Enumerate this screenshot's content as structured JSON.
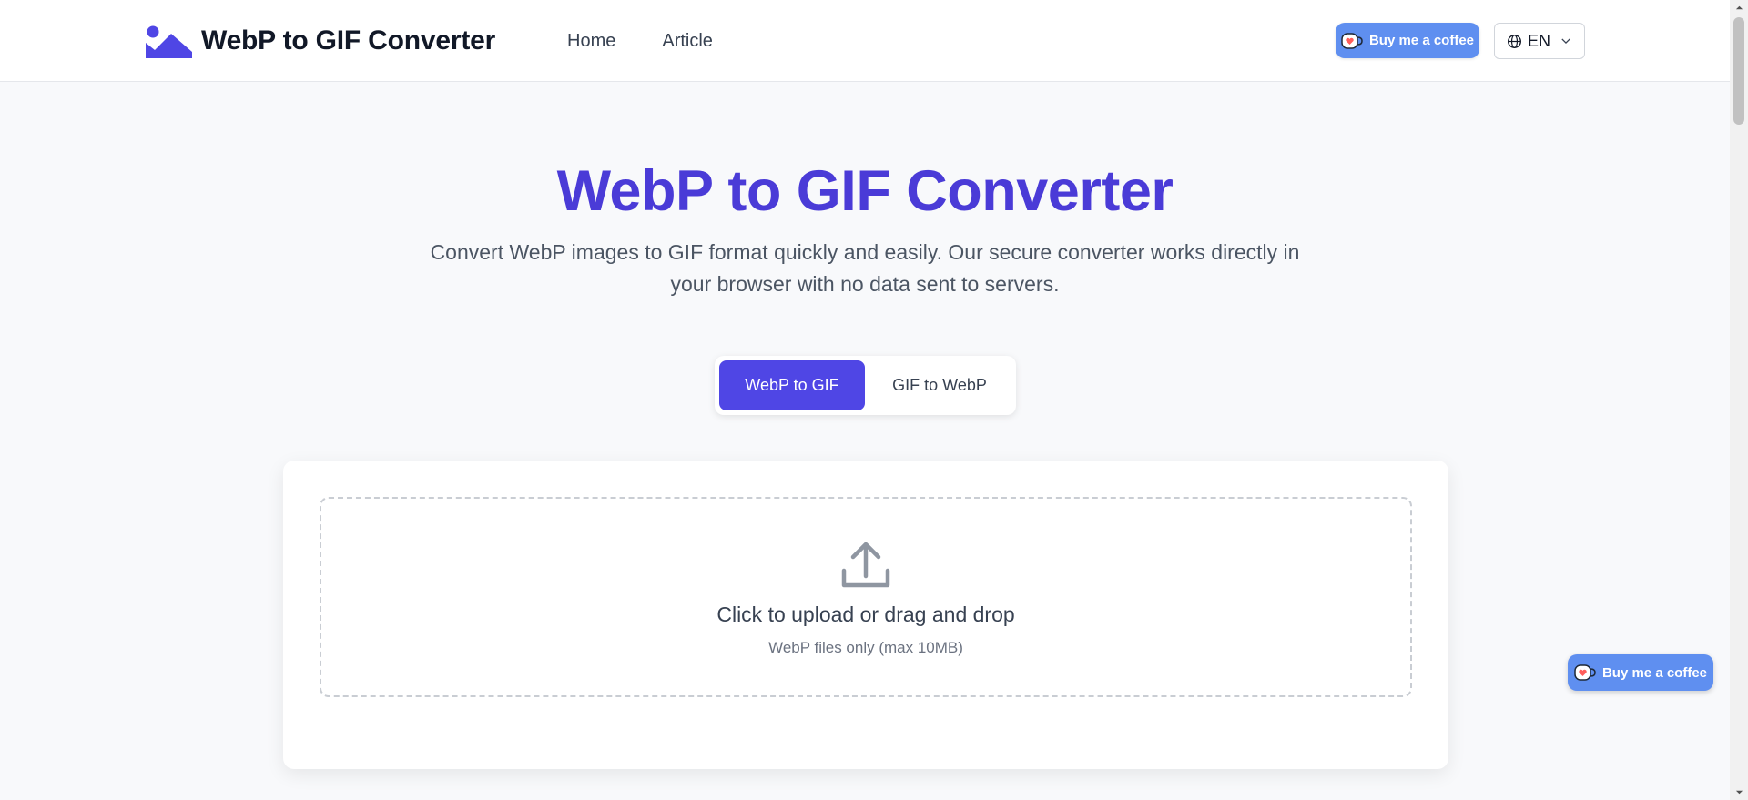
{
  "header": {
    "logo_text": "WebP to GIF Converter",
    "nav": [
      {
        "label": "Home"
      },
      {
        "label": "Article"
      }
    ],
    "coffee_label": "Buy me a coffee",
    "language": "EN"
  },
  "hero": {
    "title": "WebP to GIF Converter",
    "subtitle": "Convert WebP images to GIF format quickly and easily. Our secure converter works directly in your browser with no data sent to servers."
  },
  "tabs": [
    {
      "label": "WebP to GIF",
      "active": true
    },
    {
      "label": "GIF to WebP",
      "active": false
    }
  ],
  "upload": {
    "title": "Click to upload or drag and drop",
    "hint": "WebP files only (max 10MB)"
  },
  "floating": {
    "coffee_label": "Buy me a coffee"
  },
  "colors": {
    "brand": "#4a3bd7",
    "active_tab": "#4f46e5",
    "coffee_button": "#5f8ff0"
  },
  "icons": {
    "logo": "mountain-image-icon",
    "coffee": "coffee-cup-icon",
    "language": "globe-icon",
    "dropdown": "chevron-down-icon",
    "upload": "upload-icon"
  }
}
